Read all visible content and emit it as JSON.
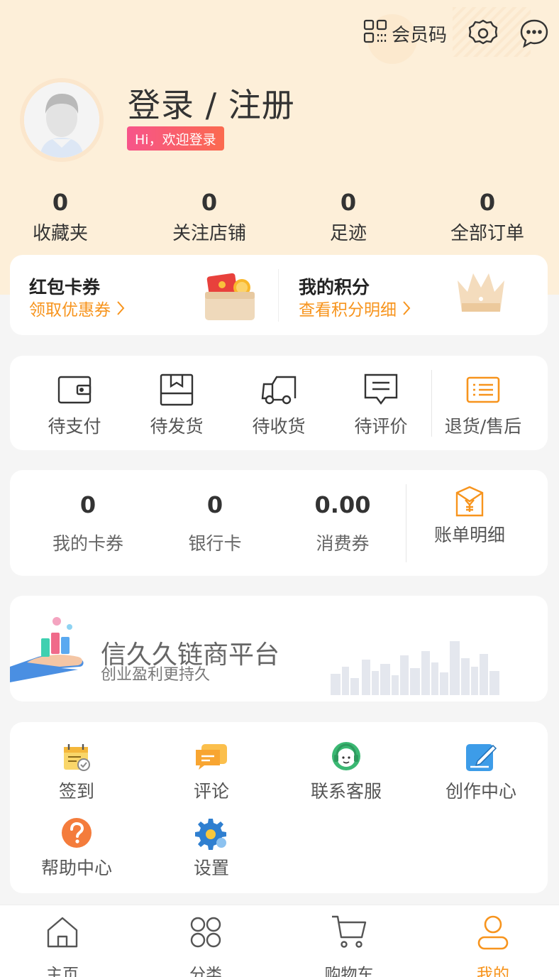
{
  "header": {
    "member_code_label": "会员码",
    "login_title": "登录 / 注册",
    "welcome_badge": "Hi，欢迎登录"
  },
  "stats": [
    {
      "value": "0",
      "label": "收藏夹"
    },
    {
      "value": "0",
      "label": "关注店铺"
    },
    {
      "value": "0",
      "label": "足迹"
    },
    {
      "value": "0",
      "label": "全部订单"
    }
  ],
  "coupons": {
    "red_packet": {
      "title": "红包卡券",
      "link": "领取优惠券"
    },
    "points": {
      "title": "我的积分",
      "link": "查看积分明细"
    }
  },
  "orders": [
    {
      "label": "待支付",
      "icon": "wallet-icon"
    },
    {
      "label": "待发货",
      "icon": "box-icon"
    },
    {
      "label": "待收货",
      "icon": "truck-icon"
    },
    {
      "label": "待评价",
      "icon": "comment-icon"
    },
    {
      "label": "退货/售后",
      "icon": "list-icon"
    }
  ],
  "wallet": [
    {
      "value": "0",
      "label": "我的卡券"
    },
    {
      "value": "0",
      "label": "银行卡"
    },
    {
      "value": "0.00",
      "label": "消费券"
    }
  ],
  "bill": {
    "label": "账单明细",
    "icon": "bill-envelope-icon"
  },
  "banner": {
    "title": "信久久链商平台",
    "subtitle": "创业盈利更持久"
  },
  "tools": [
    {
      "label": "签到",
      "icon": "checkin-icon"
    },
    {
      "label": "评论",
      "icon": "review-icon"
    },
    {
      "label": "联系客服",
      "icon": "customer-service-icon"
    },
    {
      "label": "创作中心",
      "icon": "create-icon"
    },
    {
      "label": "帮助中心",
      "icon": "help-icon"
    },
    {
      "label": "设置",
      "icon": "settings-gear-icon"
    }
  ],
  "tabbar": [
    {
      "label": "主页",
      "icon": "home-icon"
    },
    {
      "label": "分类",
      "icon": "category-icon"
    },
    {
      "label": "购物车",
      "icon": "cart-icon"
    },
    {
      "label": "我的",
      "icon": "user-icon",
      "active": true
    }
  ],
  "colors": {
    "accent": "#f7941d",
    "header_bg": "#fdefd9",
    "badge_start": "#f7548a",
    "badge_end": "#fb6a4f"
  }
}
